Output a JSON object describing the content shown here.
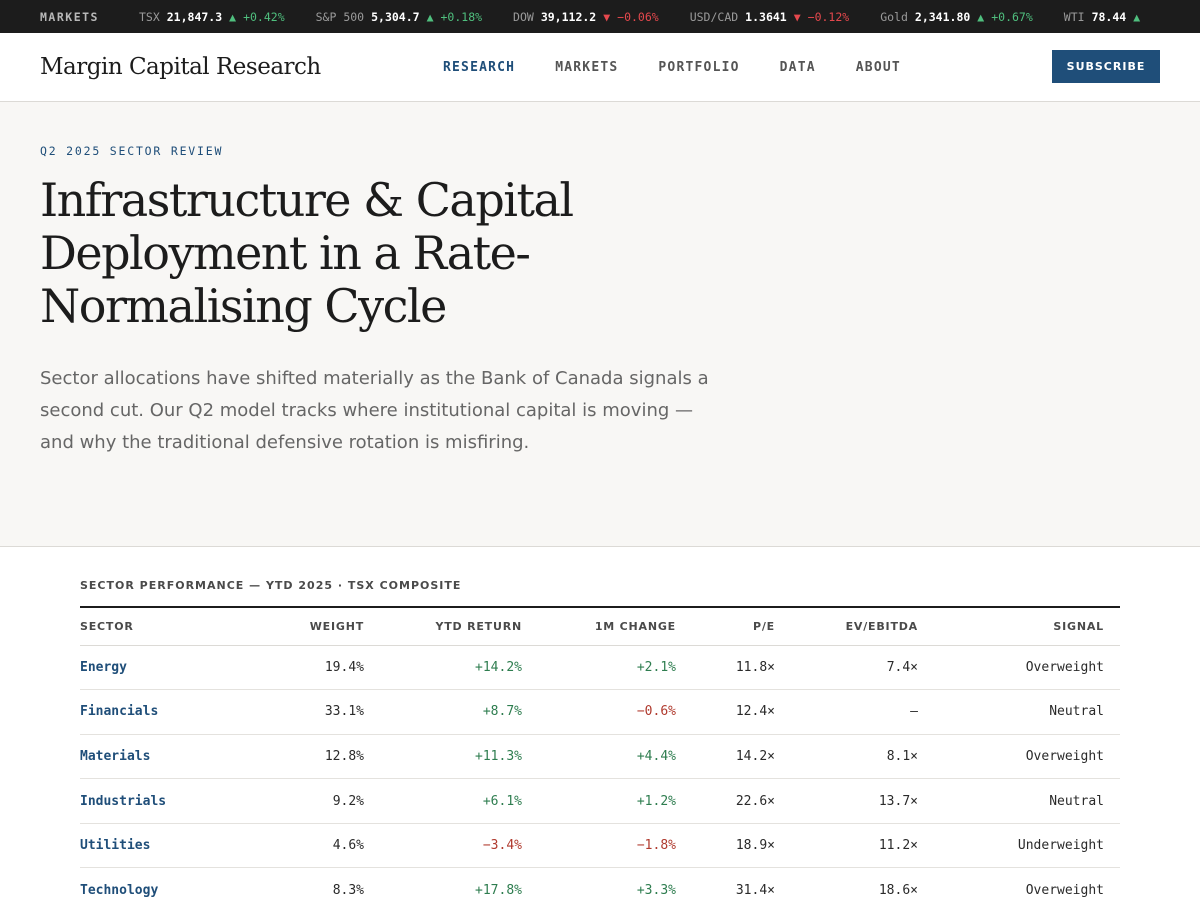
{
  "ticker": {
    "label": "MARKETS",
    "items": [
      {
        "name": "TSX",
        "value": "21,847.3",
        "arrow": "▲",
        "change": "+0.42%",
        "dir": "up"
      },
      {
        "name": "S&P 500",
        "value": "5,304.7",
        "arrow": "▲",
        "change": "+0.18%",
        "dir": "up"
      },
      {
        "name": "DOW",
        "value": "39,112.2",
        "arrow": "▼",
        "change": "−0.06%",
        "dir": "down"
      },
      {
        "name": "USD/CAD",
        "value": "1.3641",
        "arrow": "▼",
        "change": "−0.12%",
        "dir": "down"
      },
      {
        "name": "Gold",
        "value": "2,341.80",
        "arrow": "▲",
        "change": "+0.67%",
        "dir": "up"
      },
      {
        "name": "WTI",
        "value": "78.44",
        "arrow": "▲",
        "change": "",
        "dir": "up"
      }
    ]
  },
  "header": {
    "logo": "Margin Capital Research",
    "nav": [
      {
        "label": "RESEARCH",
        "active": true
      },
      {
        "label": "MARKETS",
        "active": false
      },
      {
        "label": "PORTFOLIO",
        "active": false
      },
      {
        "label": "DATA",
        "active": false
      },
      {
        "label": "ABOUT",
        "active": false
      }
    ],
    "subscribe_label": "SUBSCRIBE"
  },
  "hero": {
    "eyebrow": "Q2 2025 SECTOR REVIEW",
    "title": "Infrastructure & Capital Deployment in a Rate-Normalising Cycle",
    "lede": "Sector allocations have shifted materially as the Bank of Canada signals a second cut. Our Q2 model tracks where institutional capital is moving — and why the traditional defensive rotation is misfiring."
  },
  "table": {
    "caption": "SECTOR PERFORMANCE — YTD 2025 · TSX COMPOSITE",
    "headers": {
      "sector": "SECTOR",
      "weight": "WEIGHT",
      "ytd": "YTD RETURN",
      "m1": "1M CHANGE",
      "pe": "P/E",
      "ev": "EV/EBITDA",
      "signal": "SIGNAL"
    },
    "rows": [
      {
        "sector": "Energy",
        "weight": "19.4%",
        "ytd": "+14.2%",
        "m1": "+2.1%",
        "pe": "11.8×",
        "ev": "7.4×",
        "signal": "Overweight"
      },
      {
        "sector": "Financials",
        "weight": "33.1%",
        "ytd": "+8.7%",
        "m1": "−0.6%",
        "pe": "12.4×",
        "ev": "—",
        "signal": "Neutral"
      },
      {
        "sector": "Materials",
        "weight": "12.8%",
        "ytd": "+11.3%",
        "m1": "+4.4%",
        "pe": "14.2×",
        "ev": "8.1×",
        "signal": "Overweight"
      },
      {
        "sector": "Industrials",
        "weight": "9.2%",
        "ytd": "+6.1%",
        "m1": "+1.2%",
        "pe": "22.6×",
        "ev": "13.7×",
        "signal": "Neutral"
      },
      {
        "sector": "Utilities",
        "weight": "4.6%",
        "ytd": "−3.4%",
        "m1": "−1.8%",
        "pe": "18.9×",
        "ev": "11.2×",
        "signal": "Underweight"
      },
      {
        "sector": "Technology",
        "weight": "8.3%",
        "ytd": "+17.8%",
        "m1": "+3.3%",
        "pe": "31.4×",
        "ev": "18.6×",
        "signal": "Overweight"
      }
    ]
  }
}
